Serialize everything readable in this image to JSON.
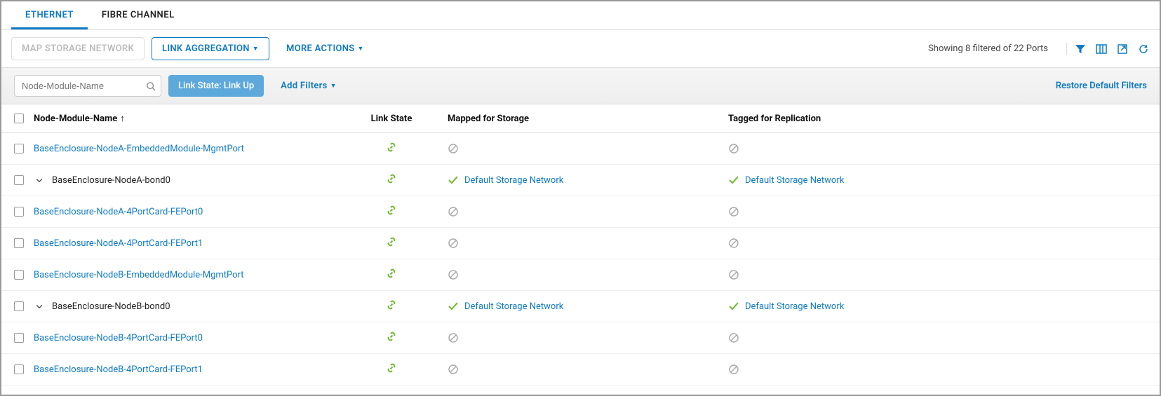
{
  "tabs": {
    "ethernet": "ETHERNET",
    "fibre_channel": "FIBRE CHANNEL"
  },
  "toolbar": {
    "map_storage": "MAP STORAGE NETWORK",
    "link_aggregation": "LINK AGGREGATION",
    "more_actions": "MORE ACTIONS",
    "showing_text": "Showing 8 filtered of 22 Ports"
  },
  "filter_bar": {
    "search_placeholder": "Node-Module-Name",
    "chip": "Link State: Link Up",
    "add_filters": "Add Filters",
    "restore": "Restore Default Filters"
  },
  "headers": {
    "name": "Node-Module-Name",
    "link_state": "Link State",
    "mapped": "Mapped for Storage",
    "tagged": "Tagged for Replication"
  },
  "storage_network_label": "Default Storage Network",
  "rows": [
    {
      "name": "BaseEnclosure-NodeA-EmbeddedModule-MgmtPort",
      "is_link": true,
      "expandable": false,
      "indent": 0,
      "mapped": "none",
      "tagged": "none"
    },
    {
      "name": "BaseEnclosure-NodeA-bond0",
      "is_link": false,
      "expandable": true,
      "indent": 1,
      "mapped": "default",
      "tagged": "default"
    },
    {
      "name": "BaseEnclosure-NodeA-4PortCard-FEPort0",
      "is_link": true,
      "expandable": false,
      "indent": 2,
      "mapped": "none",
      "tagged": "none"
    },
    {
      "name": "BaseEnclosure-NodeA-4PortCard-FEPort1",
      "is_link": true,
      "expandable": false,
      "indent": 2,
      "mapped": "none",
      "tagged": "none"
    },
    {
      "name": "BaseEnclosure-NodeB-EmbeddedModule-MgmtPort",
      "is_link": true,
      "expandable": false,
      "indent": 0,
      "mapped": "none",
      "tagged": "none"
    },
    {
      "name": "BaseEnclosure-NodeB-bond0",
      "is_link": false,
      "expandable": true,
      "indent": 1,
      "mapped": "default",
      "tagged": "default"
    },
    {
      "name": "BaseEnclosure-NodeB-4PortCard-FEPort0",
      "is_link": true,
      "expandable": false,
      "indent": 2,
      "mapped": "none",
      "tagged": "none"
    },
    {
      "name": "BaseEnclosure-NodeB-4PortCard-FEPort1",
      "is_link": true,
      "expandable": false,
      "indent": 2,
      "mapped": "none",
      "tagged": "none"
    }
  ]
}
